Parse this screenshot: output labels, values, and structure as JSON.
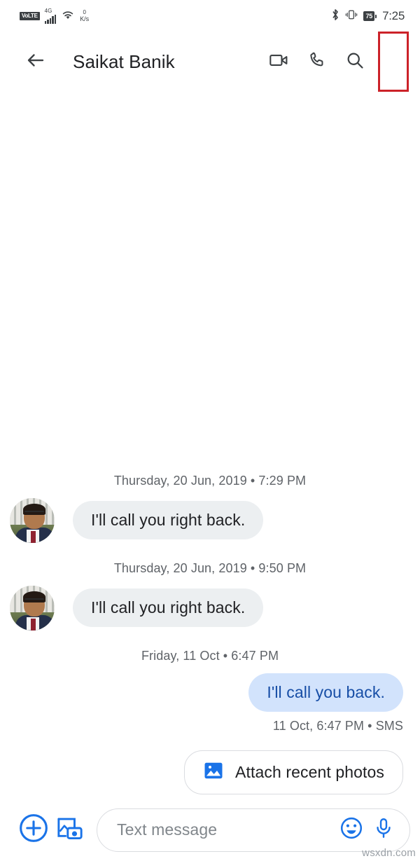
{
  "status_bar": {
    "volte_label": "VoLTE",
    "network_type": "4G",
    "wifi_icon": "wifi-icon",
    "data_speed_value": "0",
    "data_speed_unit": "K/s",
    "bluetooth_icon": "bluetooth-icon",
    "vibrate_icon": "vibrate-icon",
    "battery_percent": "75",
    "time": "7:25"
  },
  "app_bar": {
    "back_icon": "back-arrow-icon",
    "title": "Saikat Banik",
    "video_call_icon": "video-call-icon",
    "voice_call_icon": "phone-call-icon",
    "search_icon": "search-icon",
    "overflow_icon": "overflow-menu-icon",
    "highlight_color": "#cc2229"
  },
  "conversation": {
    "groups": [
      {
        "divider": "Thursday, 20 Jun, 2019 • 7:29 PM",
        "message": "I'll call you right back.",
        "direction": "incoming"
      },
      {
        "divider": "Thursday, 20 Jun, 2019 • 9:50 PM",
        "message": "I'll call you right back.",
        "direction": "incoming"
      },
      {
        "divider": "Friday, 11 Oct • 6:47 PM",
        "message": "I'll call you back.",
        "direction": "outgoing",
        "delivery": "11 Oct, 6:47 PM • SMS"
      }
    ],
    "incoming_bubble_color": "#eceff1",
    "outgoing_bubble_color": "#d2e3fc",
    "outgoing_text_color": "#174ea6"
  },
  "suggestion_chip": {
    "icon": "photo-image-icon",
    "label": "Attach recent photos",
    "icon_color": "#1a73e8"
  },
  "compose_bar": {
    "plus_icon": "plus-circle-icon",
    "gallery_icon": "gallery-camera-icon",
    "placeholder": "Text message",
    "emoji_icon": "emoji-smiley-icon",
    "mic_icon": "microphone-icon",
    "accent_color": "#1a73e8"
  },
  "watermark": {
    "text": "wsxdn.com"
  }
}
